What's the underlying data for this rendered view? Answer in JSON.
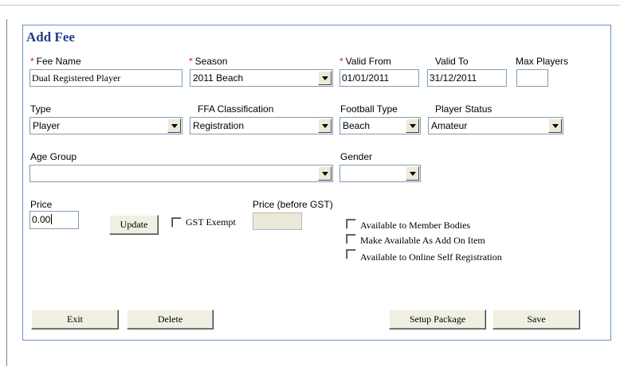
{
  "form": {
    "title": "Add Fee",
    "required_marker": "*",
    "fee_name": {
      "label": "Fee Name",
      "value": "Dual Registered Player"
    },
    "season": {
      "label": "Season",
      "value": "2011 Beach"
    },
    "valid_from": {
      "label": "Valid From",
      "value": "01/01/2011"
    },
    "valid_to": {
      "label": "Valid To",
      "value": "31/12/2011"
    },
    "max_players": {
      "label": "Max Players",
      "value": ""
    },
    "type": {
      "label": "Type",
      "value": "Player"
    },
    "ffa_classification": {
      "label": "FFA Classification",
      "value": "Registration"
    },
    "football_type": {
      "label": "Football Type",
      "value": "Beach"
    },
    "player_status": {
      "label": "Player Status",
      "value": "Amateur"
    },
    "age_group": {
      "label": "Age Group",
      "value": ""
    },
    "gender": {
      "label": "Gender",
      "value": ""
    },
    "price": {
      "label": "Price",
      "value": "0.00"
    },
    "update_label": "Update",
    "gst_exempt": {
      "label": "GST Exempt",
      "checked": false
    },
    "price_before_gst": {
      "label": "Price (before GST)",
      "value": ""
    },
    "options": [
      {
        "label": "Available to Member Bodies",
        "checked": false
      },
      {
        "label": "Make Available As Add On Item",
        "checked": false
      },
      {
        "label": "Available to Online Self Registration",
        "checked": false
      }
    ],
    "buttons": {
      "exit": "Exit",
      "delete": "Delete",
      "setup_package": "Setup Package",
      "save": "Save"
    }
  },
  "colors": {
    "title": "#1f3f86",
    "required": "#d21a1a",
    "panel_border": "#6b8fbf",
    "button_face": "#f1efe2"
  }
}
